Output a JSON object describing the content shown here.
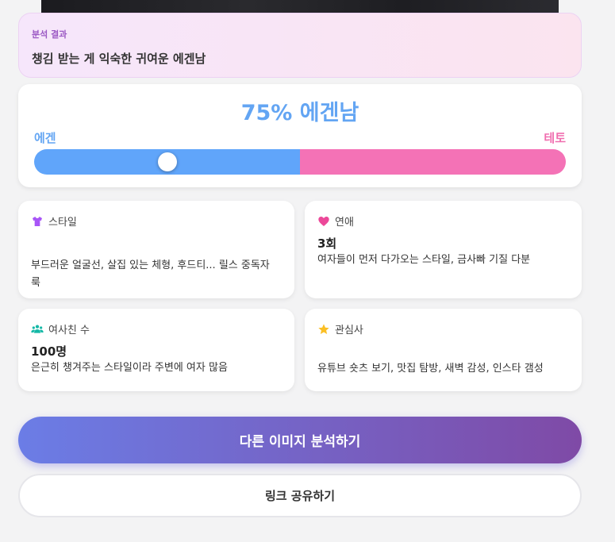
{
  "result": {
    "label": "분석 결과",
    "text": "챙김 받는 게 익숙한 귀여운 에겐남"
  },
  "ratio": {
    "title": "75% 에겐남",
    "left_label": "에겐",
    "right_label": "테토",
    "egen_fraction": 0.5,
    "knob_position": 0.25,
    "left_color": "#60a5fa",
    "right_color": "#f472b6"
  },
  "cards": {
    "style": {
      "icon": "shirt-icon",
      "title": "스타일",
      "value": "",
      "desc": "부드러운 얼굴선, 살집 있는 체형, 후드티... 릴스 중독자 룩"
    },
    "dating": {
      "icon": "heart-icon",
      "title": "연애",
      "value": "3회",
      "desc": "여자들이 먼저 다가오는 스타일, 금사빠 기질 다분"
    },
    "female_friends": {
      "icon": "users-icon",
      "title": "여사친 수",
      "value": "100명",
      "desc": "은근히 챙겨주는 스타일이라 주변에 여자 많음"
    },
    "interests": {
      "icon": "star-icon",
      "title": "관심사",
      "value": "",
      "desc": "유튜브 숏츠 보기, 맛집 탐방, 새벽 감성, 인스타 갬성"
    }
  },
  "buttons": {
    "analyze_again": "다른 이미지 분석하기",
    "share_link": "링크 공유하기"
  }
}
